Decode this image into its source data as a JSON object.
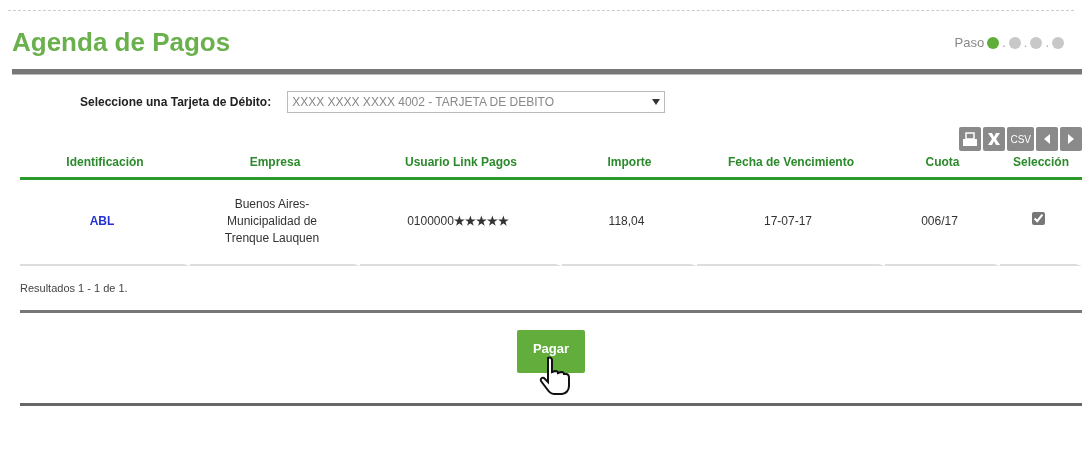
{
  "title": "Agenda de Pagos",
  "steps": {
    "label": "Paso",
    "items": [
      {
        "selected": true
      },
      {
        "selected": false
      },
      {
        "selected": false
      },
      {
        "selected": false
      }
    ],
    "separator": "."
  },
  "card_select": {
    "label": "Seleccione una Tarjeta de Débito:",
    "value": "XXXX XXXX XXXX 4002 - TARJETA DE DEBITO"
  },
  "toolbar": {
    "csv_label": "CSV"
  },
  "table": {
    "columns": [
      "Identificación",
      "Empresa",
      "Usuario Link Pagos",
      "Importe",
      "Fecha de Vencimiento",
      "Cuota",
      "Selección"
    ],
    "rows": [
      {
        "identificacion": "ABL",
        "empresa": "Buenos Aires-Municipalidad de Trenque Lauquen",
        "usuario": "0100000",
        "usuario_masked": "★★★★★",
        "importe": "118,04",
        "fecha": "17-07-17",
        "cuota": "006/17",
        "checked": true
      }
    ]
  },
  "results": "Resultados 1 - 1 de 1.",
  "pay_button": "Pagar"
}
